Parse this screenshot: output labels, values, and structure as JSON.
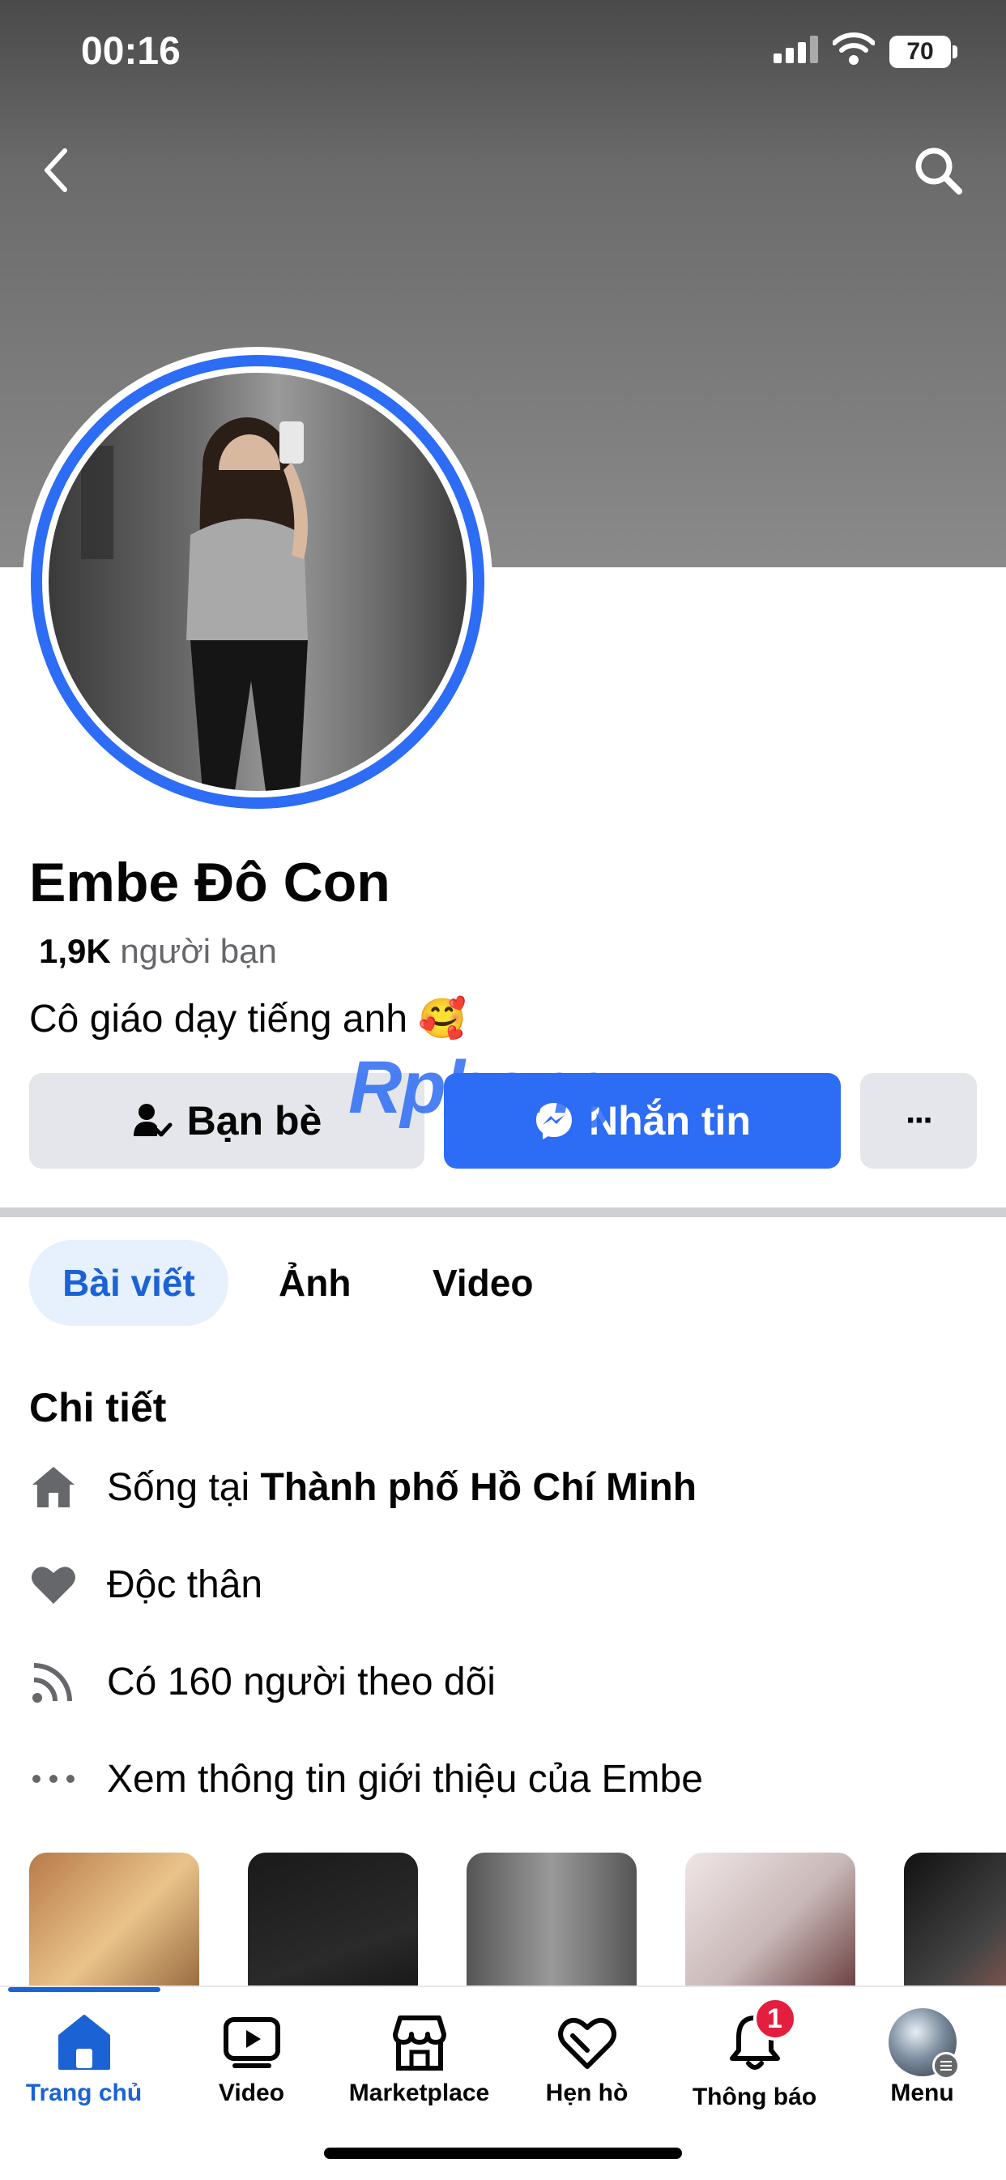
{
  "status_bar": {
    "time": "00:16",
    "battery": "70"
  },
  "profile": {
    "name": "Embe Đô Con",
    "friends_count": "1,9K",
    "friends_label": "người bạn",
    "bio": "Cô giáo dạy tiếng anh 🥰"
  },
  "actions": {
    "friends_button": "Bạn bè",
    "message_button": "Nhắn tin",
    "more_button": "···"
  },
  "watermark": {
    "part1": "R",
    "part2": "phang"
  },
  "tabs": [
    {
      "label": "Bài viết"
    },
    {
      "label": "Ảnh"
    },
    {
      "label": "Video"
    }
  ],
  "details": {
    "title": "Chi tiết",
    "lives_prefix": "Sống tại ",
    "lives_city": "Thành phố Hồ Chí Minh",
    "relationship": "Độc thân",
    "followers": "Có 160 người theo dõi",
    "see_about": "Xem thông tin giới thiệu của Embe"
  },
  "bottom_nav": [
    {
      "label": "Trang chủ",
      "icon": "home-icon"
    },
    {
      "label": "Video",
      "icon": "video-icon"
    },
    {
      "label": "Marketplace",
      "icon": "marketplace-icon"
    },
    {
      "label": "Hẹn hò",
      "icon": "dating-heart-icon"
    },
    {
      "label": "Thông báo",
      "icon": "bell-icon",
      "badge": "1"
    },
    {
      "label": "Menu",
      "icon": "menu-avatar-icon"
    }
  ],
  "colors": {
    "accent": "#2d6cf5",
    "active_tab": "#1b63d4",
    "badge": "#e41e3f"
  }
}
